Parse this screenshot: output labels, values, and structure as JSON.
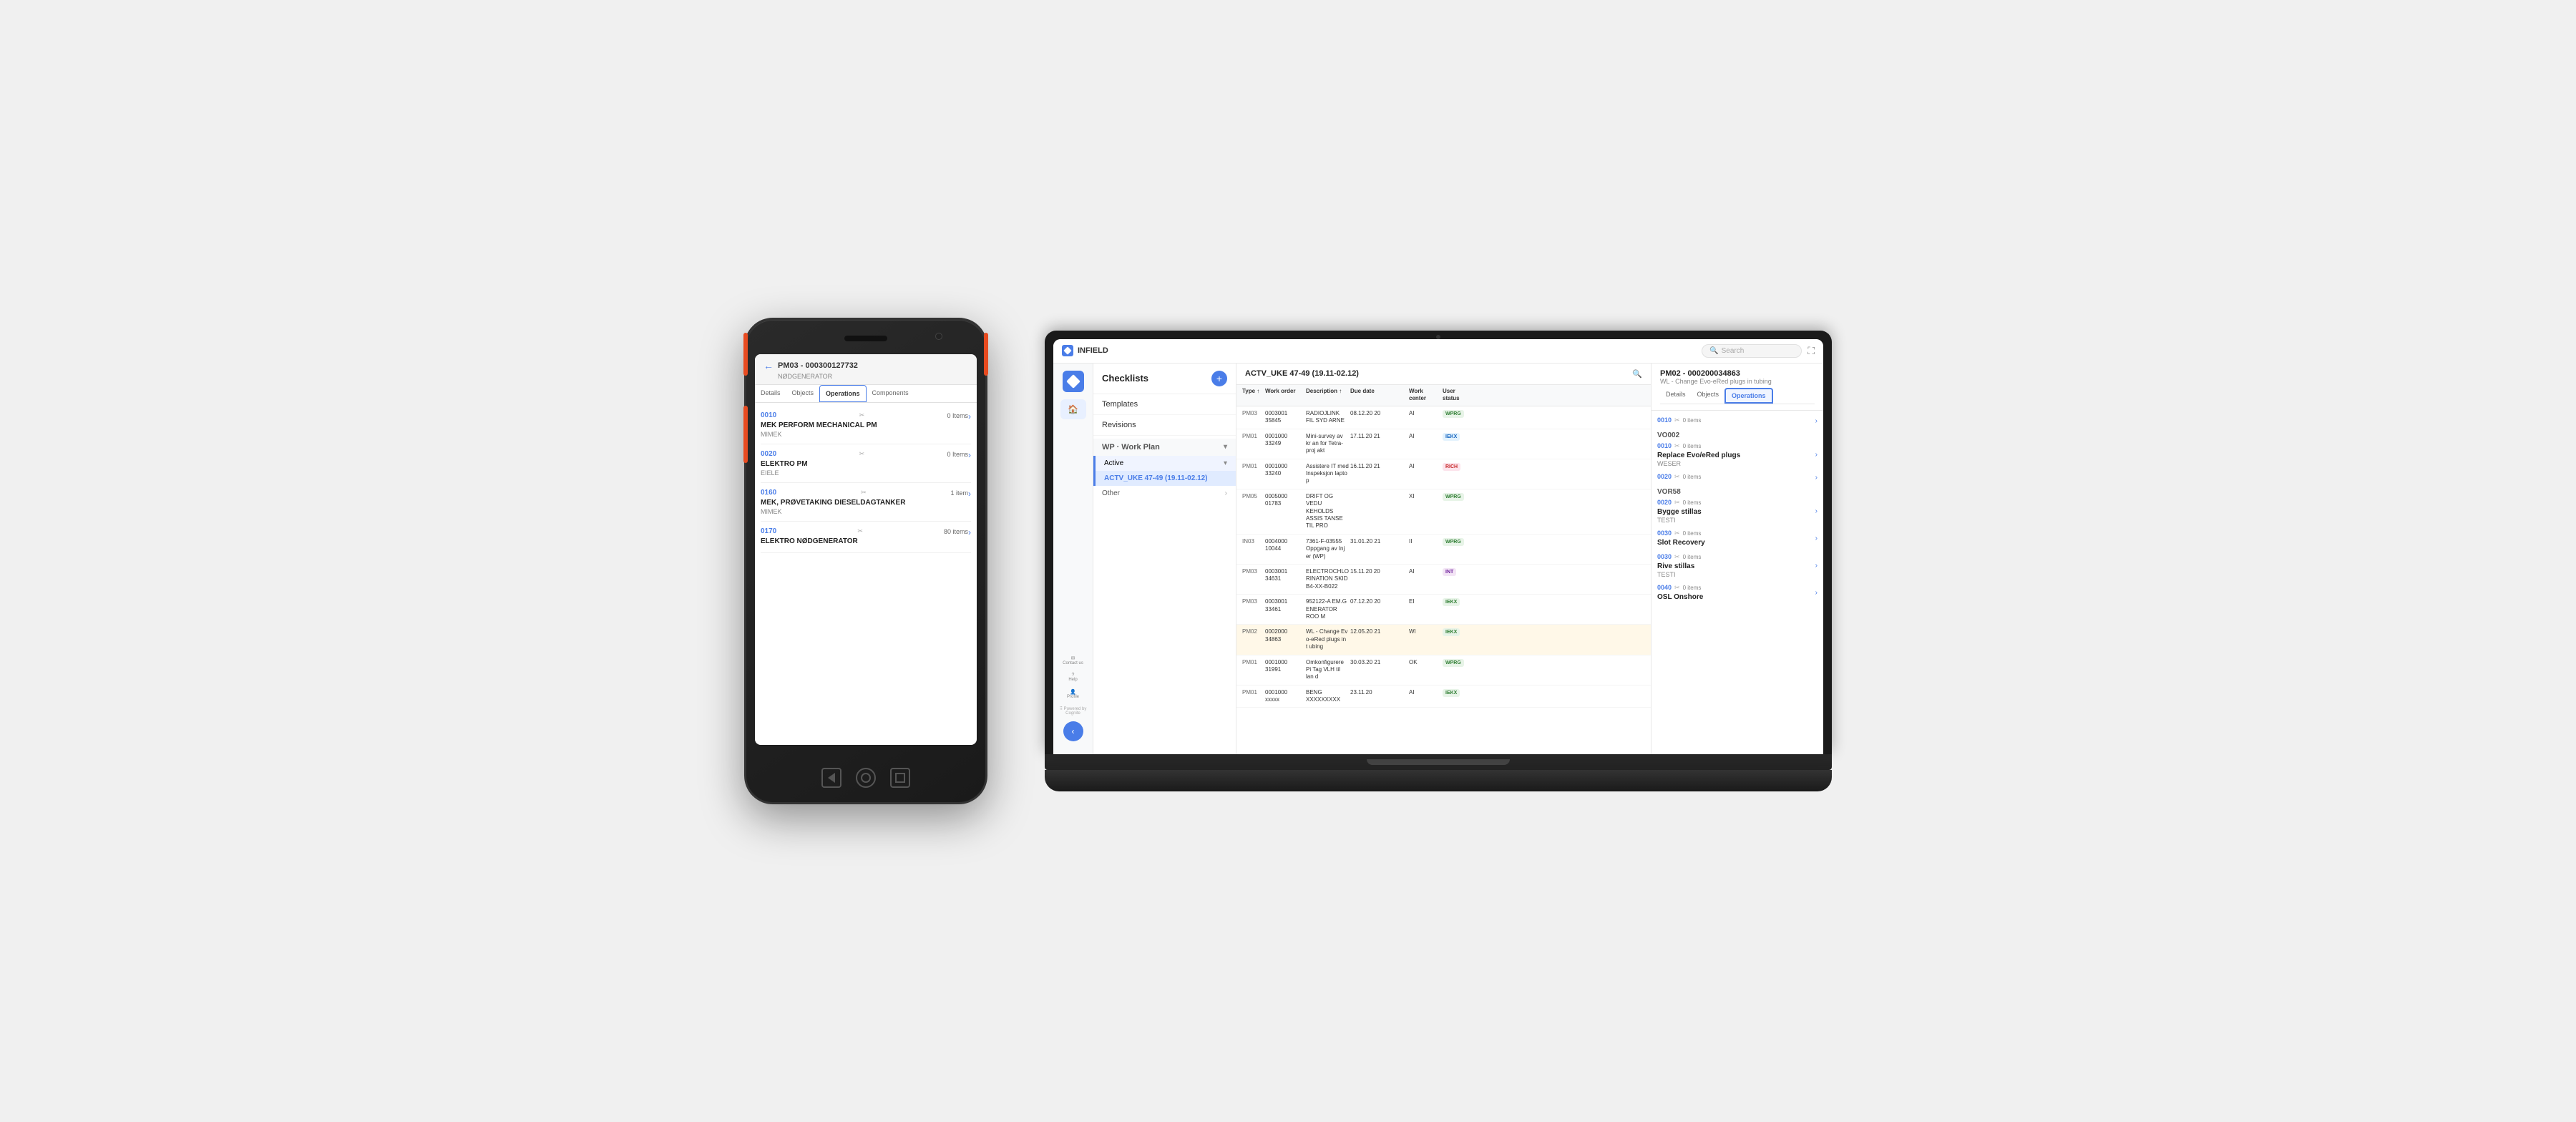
{
  "phone": {
    "wo_id": "PM03 - 000300127732",
    "wo_sub": "NØDGENERATOR",
    "back_label": "←",
    "tabs": [
      "Details",
      "Objects",
      "Operations",
      "Components"
    ],
    "active_tab": "Operations",
    "items": [
      {
        "code": "0010",
        "badge": "0 items",
        "title": "MEK PERFORM MECHANICAL PM",
        "sub": "MIMEK",
        "has_item": false
      },
      {
        "code": "0020",
        "badge": "0 items",
        "title": "ELEKTRO PM",
        "sub": "EIELE",
        "has_item": false
      },
      {
        "code": "0160",
        "badge": "1 item",
        "title": "MEK, PRØVETAKING DIESELDAGTANKER",
        "sub": "MIMEK",
        "has_item": true
      },
      {
        "code": "0170",
        "badge": "80 items",
        "title": "ELEKTRO NØDGENERATOR",
        "sub": "",
        "has_item": false
      }
    ]
  },
  "laptop": {
    "app_name": "INFIELD",
    "search_placeholder": "Search",
    "home_label": "Home",
    "panels": {
      "checklists": {
        "title": "Checklists",
        "add_label": "+",
        "items": [
          "Templates",
          "Revisions"
        ],
        "wp_label": "WP · Work Plan",
        "active_label": "Active",
        "active_item": "ACTV_UKE 47-49 (19.11-02.12)",
        "other_label": "Other"
      },
      "workorders": {
        "title": "ACTV_UKE 47-49 (19.11-02.12)",
        "columns": [
          "Type ↑",
          "Work order",
          "Description ↑",
          "Due date",
          "Work center",
          "User status",
          ""
        ],
        "rows": [
          {
            "type": "PM03",
            "wo": "0003001 35845",
            "desc": "RADIOJLINK FIL SYD ARNE",
            "due": "08.1.2.20 20",
            "wc": "AI",
            "status": "WPRG"
          },
          {
            "type": "PM01",
            "wo": "0001000 33240",
            "desc": "Mini-survey av kr an for Tetra-proji akt",
            "due": "17.11.20 21",
            "wc": "AI",
            "status": "IEKX"
          },
          {
            "type": "PM01",
            "wo": "0001000 33240",
            "desc": "Assistere IT med Inspeksjon lapto p",
            "due": "16.11.20 21",
            "wc": "AI",
            "status": "RICH"
          },
          {
            "type": "PM05",
            "wo": "0005000 01783",
            "desc": "DRIFT OG VEDU KEHOLDS ASSIS TANSE TIL PRO",
            "due": "",
            "wc": "XI",
            "status": "WPRG"
          },
          {
            "type": "IN03",
            "wo": "0004000 10044",
            "desc": "7361-F-03555 Oppgang av Inj er (WP)",
            "due": "31.01.20 21",
            "wc": "II",
            "status": "WPRG"
          },
          {
            "type": "PM03",
            "wo": "0003001 34631",
            "desc": "ELECTROCHLO RINATION SKID B4-XX-B022",
            "due": "15.11.20 20",
            "wc": "AI",
            "status": "INT"
          },
          {
            "type": "PM03",
            "wo": "0003001 33461",
            "desc": "952122-A EM.G ENERATOR ROO M",
            "due": "07.12.20 20",
            "wc": "EI",
            "status": "IEKX"
          },
          {
            "type": "PM02",
            "wo": "0002000 34863",
            "desc": "WL - Change Ev o-eRed plugs in t ubing",
            "due": "12.05.20 21",
            "wc": "WI",
            "status": "IEKX",
            "highlighted": true
          },
          {
            "type": "PM01",
            "wo": "0001000 31991",
            "desc": "Omkonfigurere Pi Tag VLH til lan d",
            "due": "30.03.20 21",
            "wc": "OK",
            "status": "WPRG"
          },
          {
            "type": "PM01",
            "wo": "0001000 xxxxx",
            "desc": "BENG XXXXXXX",
            "due": "23.11.20",
            "wc": "AI",
            "status": "IEKX"
          }
        ]
      },
      "operations": {
        "wo_id": "PM02 - 000200034863",
        "wo_desc": "WL - Change Evo-eRed plugs in tubing",
        "tabs": [
          "Details",
          "Objects",
          "Operations"
        ],
        "active_tab": "Operations",
        "items": [
          {
            "code": "0010",
            "badge": "0 items",
            "section": "VO002",
            "title": "",
            "sub": ""
          },
          {
            "code": "0010",
            "badge": "0 items",
            "section": "",
            "title": "Replace Evo/eRed plugs",
            "sub": "WESER"
          },
          {
            "code": "0020",
            "badge": "0 items",
            "section": "VOR58",
            "title": "",
            "sub": ""
          },
          {
            "code": "0020",
            "badge": "0 items",
            "section": "",
            "title": "Bygge stillas",
            "sub": "TESTI"
          },
          {
            "code": "0030",
            "badge": "0 items",
            "section": "",
            "title": "Slot Recovery",
            "sub": ""
          },
          {
            "code": "0030",
            "badge": "0 items",
            "section": "",
            "title": "Rive stillas",
            "sub": "TESTI"
          },
          {
            "code": "0040",
            "badge": "0 items",
            "section": "",
            "title": "OSL Onshore",
            "sub": ""
          }
        ]
      }
    },
    "sidebar": {
      "nav_items": [
        "🏠"
      ],
      "bottom_items": [
        "Contact us",
        "Help",
        "Profile",
        "Powered by Cognite"
      ]
    }
  }
}
